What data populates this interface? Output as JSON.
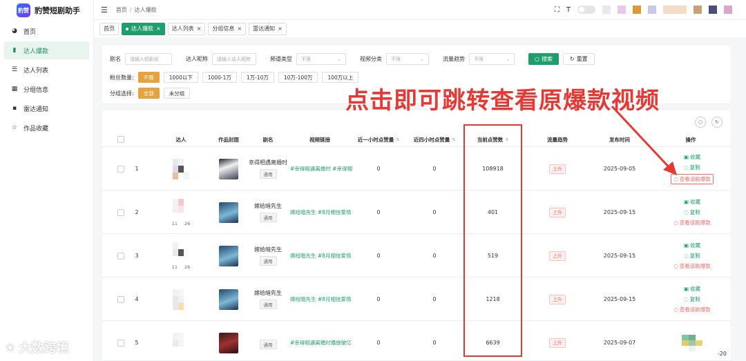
{
  "brand": {
    "logo_text": "豹赞",
    "name": "豹赞短剧助手"
  },
  "sidebar": {
    "items": [
      {
        "label": "首页",
        "icon": "dashboard-icon",
        "glyph": "◕"
      },
      {
        "label": "达人爆款",
        "icon": "bar-chart-icon",
        "glyph": "▮",
        "active": true
      },
      {
        "label": "达人列表",
        "icon": "list-icon",
        "glyph": "☰"
      },
      {
        "label": "分组信息",
        "icon": "group-icon",
        "glyph": "▦"
      },
      {
        "label": "雷达通知",
        "icon": "message-icon",
        "glyph": "▪"
      },
      {
        "label": "作品收藏",
        "icon": "star-icon",
        "glyph": "☆"
      }
    ]
  },
  "header": {
    "crumb_home": "首页",
    "crumb_current": "达人爆款"
  },
  "tabs": [
    {
      "label": "首页",
      "active": false,
      "closable": false
    },
    {
      "label": "达人爆款",
      "active": true,
      "closable": true
    },
    {
      "label": "达人列表",
      "active": false,
      "closable": true
    },
    {
      "label": "分组信息",
      "active": false,
      "closable": true
    },
    {
      "label": "雷达通知",
      "active": false,
      "closable": true
    }
  ],
  "filters": {
    "drama_label": "剧名",
    "drama_placeholder": "请输入短剧名",
    "talent_label": "达人昵称",
    "talent_placeholder": "请输入达人昵称",
    "channel_label": "频道类型",
    "channel_value": "不限",
    "video_cat_label": "视频分类",
    "video_cat_value": "不限",
    "traffic_label": "流量趋势",
    "traffic_value": "不限",
    "search_btn": "搜索",
    "reset_btn": "重置",
    "fans_label": "粉丝数量:",
    "fans_options": [
      "不限",
      "1000以下",
      "1000-1万",
      "1万-10万",
      "10万-100万",
      "100万以上"
    ],
    "group_label": "分组选择:",
    "group_options": [
      "全部",
      "未分组"
    ]
  },
  "table": {
    "headers": {
      "talent": "达人",
      "cover": "作品封面",
      "drama": "剧名",
      "link": "视频链接",
      "last_hour": "近一小时点赞量",
      "last_4h": "近四小时点赞量",
      "current": "当前点赞数",
      "trend": "流量趋势",
      "publish": "发布时间",
      "ops": "操作"
    },
    "op_labels": {
      "collect": "收藏",
      "copy": "复制",
      "view": "查看该剧爆款"
    },
    "rows": [
      {
        "index": "1",
        "stat1": "",
        "stat2": "",
        "drama": "幸得相遇离婚时",
        "tag": "通用",
        "link": "#幸得相遇离婚时 #幸得相遇",
        "last_hour": "0",
        "last_4h": "0",
        "current": "108918",
        "trend": "上升",
        "publish": "2025-09-05"
      },
      {
        "index": "2",
        "stat1": "11",
        "stat2": "26",
        "drama": "嫁给暗先生",
        "tag": "通用",
        "link": "嫁给暗先生 #8月相信爱情",
        "last_hour": "0",
        "last_4h": "0",
        "current": "401",
        "trend": "上升",
        "publish": "2025-09-15"
      },
      {
        "index": "3",
        "stat1": "11",
        "stat2": "26",
        "drama": "嫁给暗先生",
        "tag": "通用",
        "link": "嫁给暗先生 #8月相信爱情",
        "last_hour": "0",
        "last_4h": "0",
        "current": "519",
        "trend": "上升",
        "publish": "2025-09-15"
      },
      {
        "index": "4",
        "stat1": "",
        "stat2": "",
        "drama": "嫁给暗先生",
        "tag": "通用",
        "link": "嫁给暗先生 #8月相信爱情",
        "last_hour": "0",
        "last_4h": "0",
        "current": "1218",
        "trend": "上升",
        "publish": "2025-09-15"
      },
      {
        "index": "5",
        "stat1": "",
        "stat2": "",
        "drama": "",
        "tag": "通用",
        "link": "#幸得相遇离婚时播放破亿",
        "last_hour": "0",
        "last_4h": "0",
        "current": "6639",
        "trend": "上升",
        "publish": "2025-09-07"
      }
    ]
  },
  "annotation": {
    "text": "点击即可跳转查看原爆款视频"
  },
  "watermark": {
    "text": "大数跨境"
  },
  "pager": {
    "text": "-20"
  },
  "colors": {
    "primary": "#1e9e6a",
    "warning": "#e6a23c",
    "danger": "#e53935"
  }
}
